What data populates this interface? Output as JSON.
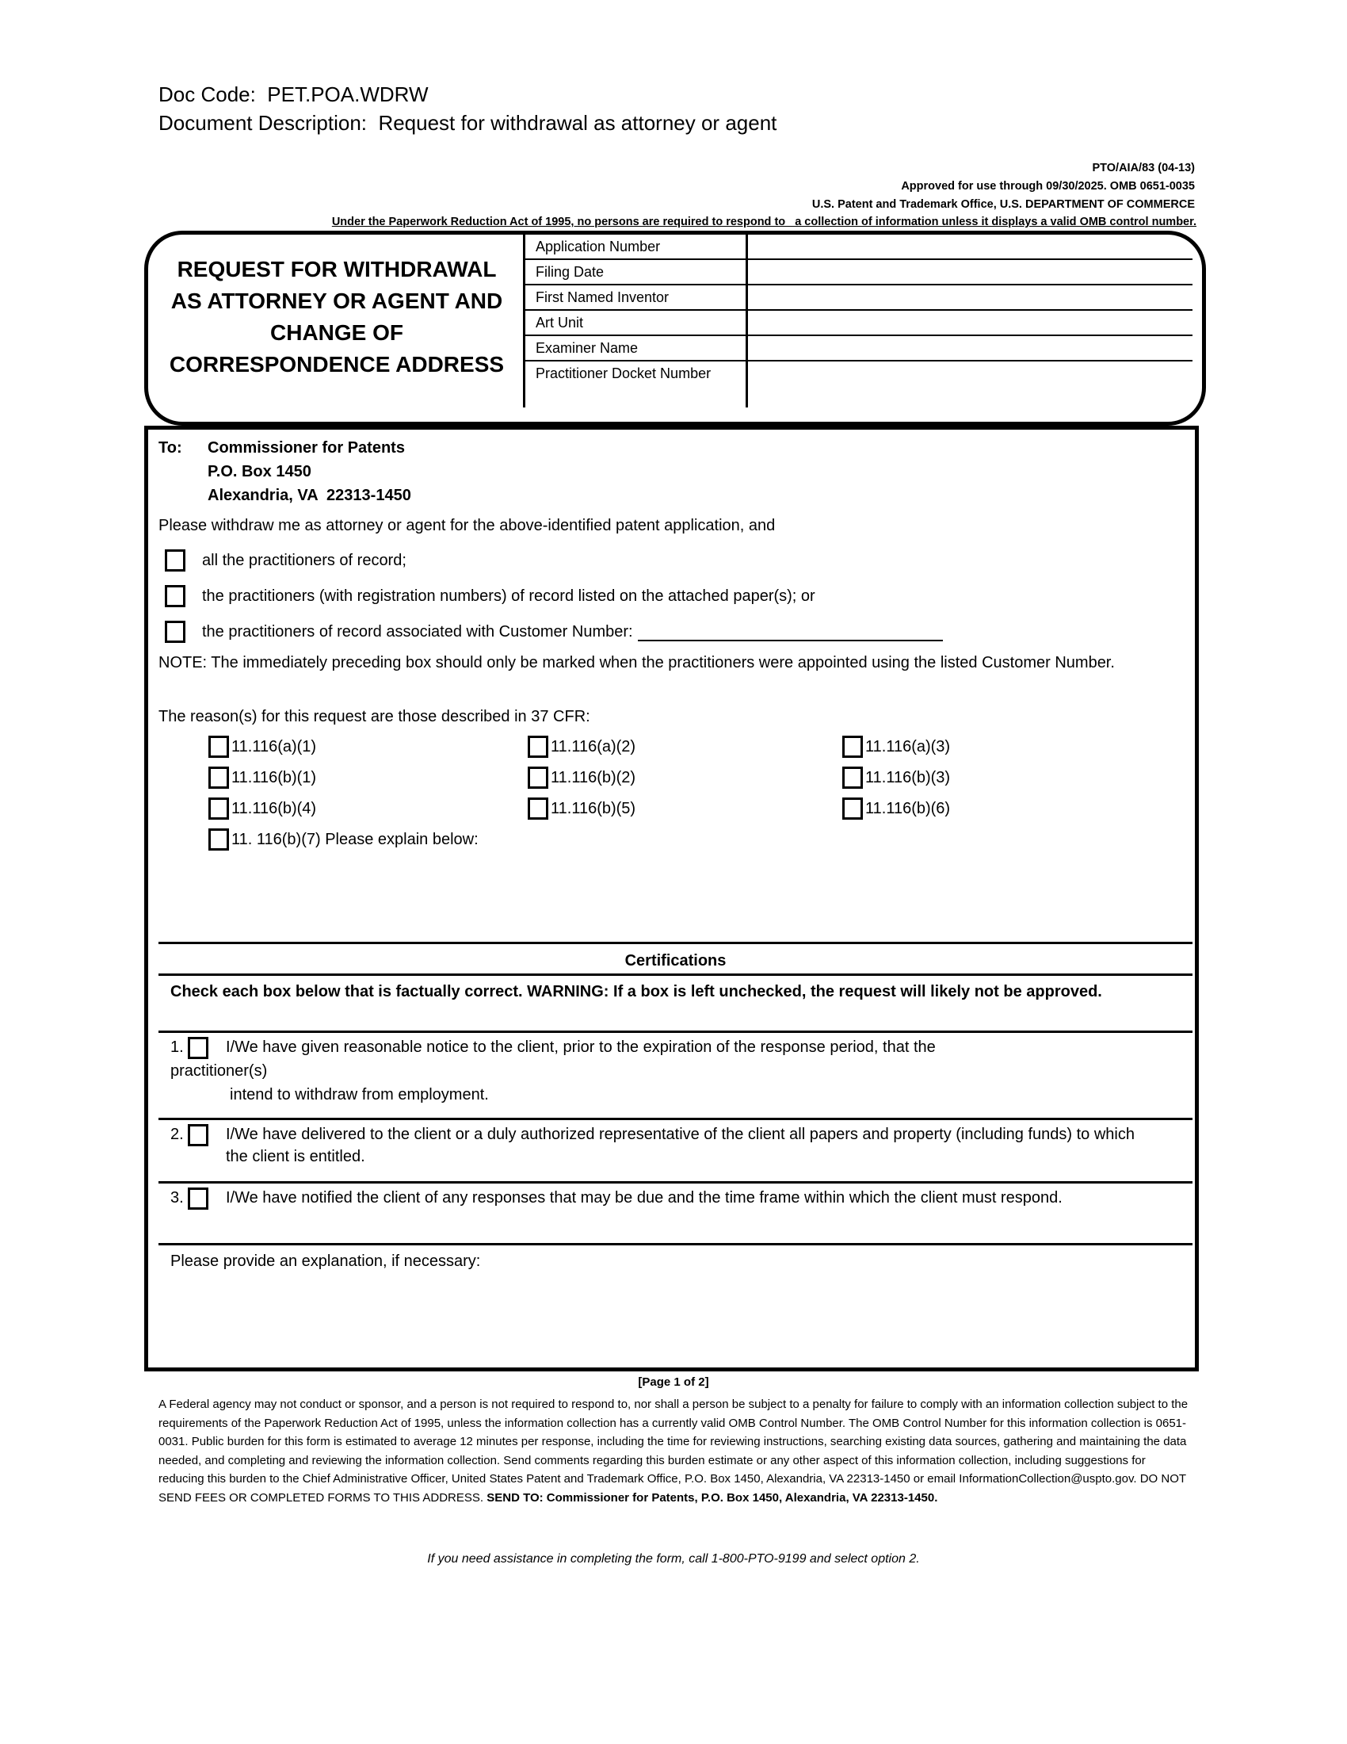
{
  "header": {
    "doc_code": "Doc Code:  PET.POA.WDRW",
    "doc_description": "Document Description:  Request for withdrawal as attorney or agent",
    "form_id": "PTO/AIA/83 (04-13)",
    "approved": "Approved for use through 09/30/2025. OMB 0651-0035",
    "department": "U.S. Patent and Trademark Office, U.S. DEPARTMENT OF COMMERCE",
    "paperwork_notice": "Under the Paperwork Reduction Act of 1995, no persons are required to respond to   a collection of information unless it displays a valid OMB control number."
  },
  "title_box": {
    "title_lines": [
      "REQUEST FOR WITHDRAWAL",
      "AS ATTORNEY OR AGENT AND",
      "CHANGE OF",
      "CORRESPONDENCE ADDRESS"
    ],
    "fields": [
      {
        "label": "Application Number",
        "value": ""
      },
      {
        "label": "Filing Date",
        "value": ""
      },
      {
        "label": "First Named Inventor",
        "value": ""
      },
      {
        "label": "Art Unit",
        "value": ""
      },
      {
        "label": "Examiner Name",
        "value": ""
      },
      {
        "label": "Practitioner Docket Number",
        "value": ""
      }
    ]
  },
  "recipient": {
    "to_label": "To:",
    "lines": [
      "Commissioner for Patents",
      "P.O. Box 1450",
      "Alexandria, VA  22313-1450"
    ]
  },
  "withdrawal": {
    "intro": "Please withdraw me as attorney or agent for the above-identified patent application, and",
    "options": [
      {
        "label": "all the practitioners of record;",
        "checked": false
      },
      {
        "label": "the practitioners (with registration numbers) of record listed on the attached paper(s); or",
        "checked": false
      },
      {
        "label": "the practitioners of record associated with Customer Number:",
        "checked": false,
        "customer_number": ""
      }
    ],
    "note": "NOTE:  The immediately preceding box should only be marked when the practitioners were appointed using the listed Customer Number."
  },
  "reasons": {
    "intro": "The reason(s) for this request are those described in 37 CFR:",
    "items": [
      {
        "label": "11.116(a)(1)",
        "checked": false
      },
      {
        "label": "11.116(a)(2)",
        "checked": false
      },
      {
        "label": "11.116(a)(3)",
        "checked": false
      },
      {
        "label": "11.116(b)(1)",
        "checked": false
      },
      {
        "label": "11.116(b)(2)",
        "checked": false
      },
      {
        "label": "11.116(b)(3)",
        "checked": false
      },
      {
        "label": "11.116(b)(4)",
        "checked": false
      },
      {
        "label": "11.116(b)(5)",
        "checked": false
      },
      {
        "label": "11.116(b)(6)",
        "checked": false
      },
      {
        "label": "11. 116(b)(7) Please explain below:",
        "checked": false
      }
    ],
    "explanation": ""
  },
  "certifications": {
    "title": "Certifications",
    "warning": "Check each box below that is factually correct. WARNING:  If a box is left unchecked, the request will likely not be approved.",
    "items": [
      {
        "number": "1.",
        "text_line1": "I/We have given reasonable notice to the client, prior to the expiration of the response period, that the",
        "text_line2": "practitioner(s)",
        "text_line3": "intend to withdraw from employment.",
        "checked": false
      },
      {
        "number": "2.",
        "text": "I/We have delivered to the client or a duly authorized representative of the client all papers and property (including funds) to which the client is entitled.",
        "checked": false
      },
      {
        "number": "3.",
        "text": "I/We have notified the client of any responses that may be due and the time frame within which the client must respond.",
        "checked": false
      }
    ],
    "explanation_label": "Please provide an explanation, if necessary:",
    "explanation": ""
  },
  "footer": {
    "page": "[Page 1 of 2]",
    "burden_text": "A Federal agency may not conduct or sponsor, and a person is not required to respond to, nor shall a person be subject to a penalty for failure to comply with an information collection subject to the requirements of the Paperwork Reduction Act of 1995, unless the information collection has a currently valid OMB Control Number. The OMB Control Number for this information collection is 0651-0031. Public burden for this form is estimated to average 12 minutes per response, including the time for reviewing instructions, searching existing data sources, gathering and maintaining the data needed, and completing and reviewing the information collection. Send comments regarding this burden estimate or any other aspect of this information collection, including suggestions for reducing this burden to the Chief Administrative Officer, United States Patent and Trademark Office, P.O. Box 1450, Alexandria, VA 22313-1450 or email InformationCollection@uspto.gov. DO NOT SEND FEES OR COMPLETED FORMS TO THIS ADDRESS.",
    "send_to": " SEND TO:  Commissioner for Patents, P.O. Box 1450, Alexandria, VA 22313-1450.",
    "assistance": "If you need assistance in completing the form, call 1-800-PTO-9199 and select option 2."
  }
}
